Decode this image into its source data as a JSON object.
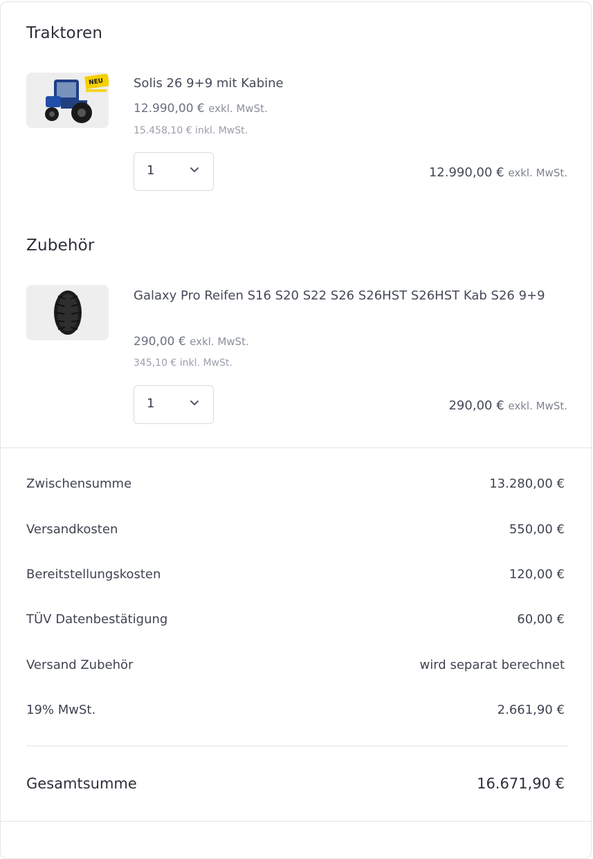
{
  "sections": [
    {
      "title": "Traktoren",
      "item": {
        "image_icon": "tractor-image",
        "badge": "NEU",
        "name": "Solis 26 9+9 mit Kabine",
        "price_excl": "12.990,00 €",
        "price_excl_unit": "exkl. MwSt.",
        "price_incl": "15.458,10 € inkl. MwSt.",
        "quantity": "1",
        "line_total": "12.990,00 €",
        "line_total_unit": "exkl. MwSt."
      }
    },
    {
      "title": "Zubehör",
      "item": {
        "image_icon": "tire-image",
        "name": "Galaxy Pro Reifen S16 S20 S22 S26 S26HST S26HST Kab S26 9+9",
        "price_excl": "290,00 €",
        "price_excl_unit": "exkl. MwSt.",
        "price_incl": "345,10 € inkl. MwSt.",
        "quantity": "1",
        "line_total": "290,00 €",
        "line_total_unit": "exkl. MwSt."
      }
    }
  ],
  "summary": [
    {
      "label": "Zwischensumme",
      "value": "13.280,00 €"
    },
    {
      "label": "Versandkosten",
      "value": "550,00 €"
    },
    {
      "label": "Bereitstellungskosten",
      "value": "120,00 €"
    },
    {
      "label": "TÜV Datenbestätigung",
      "value": "60,00 €"
    },
    {
      "label": "Versand Zubehör",
      "value": "wird separat berechnet"
    },
    {
      "label": "19% MwSt.",
      "value": "2.661,90 €"
    }
  ],
  "total": {
    "label": "Gesamtsumme",
    "value": "16.671,90 €"
  },
  "colors": {
    "border": "#e3e5e8",
    "text": "#3a3f4b",
    "muted": "#9a9ea8",
    "tractor_blue": "#1f4fa8",
    "badge_yellow": "#f5d000"
  }
}
